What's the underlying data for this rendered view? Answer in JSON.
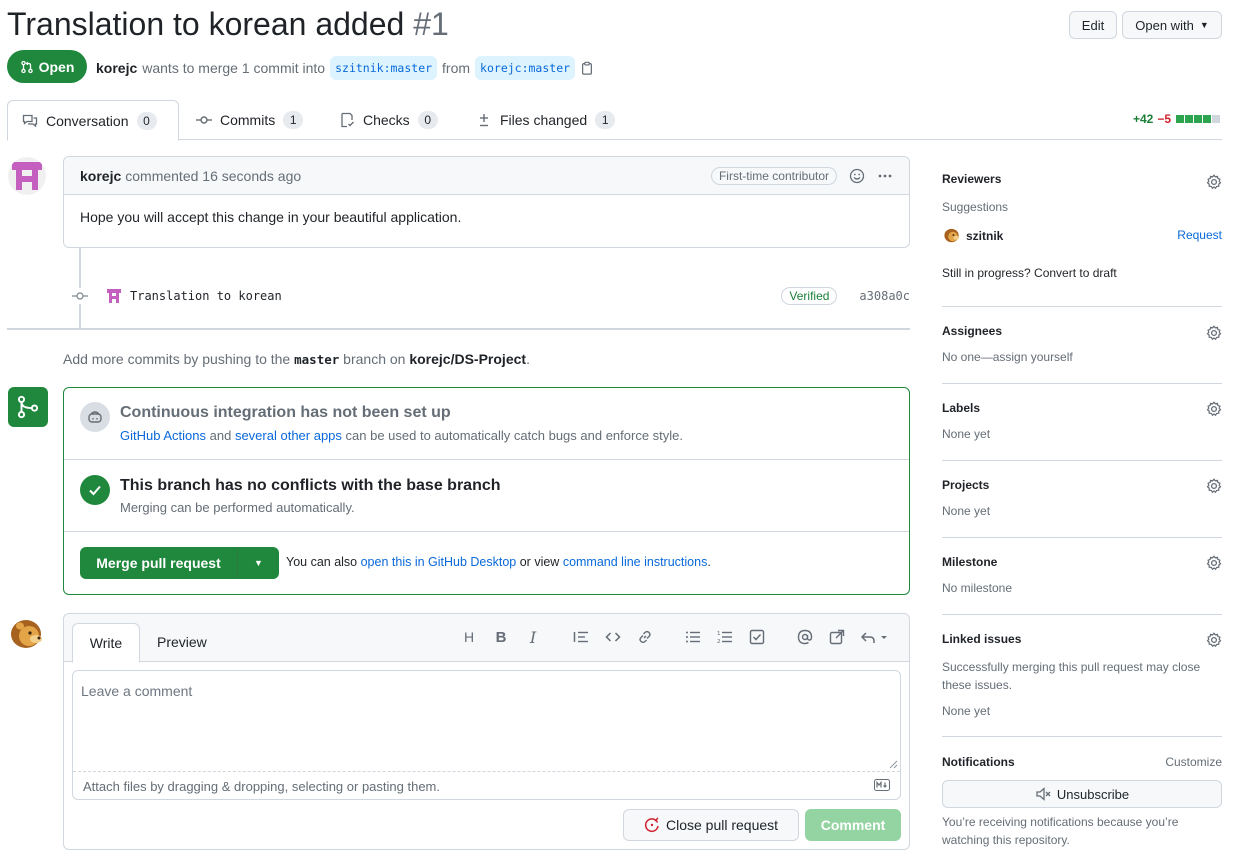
{
  "pr": {
    "title": "Translation to korean added",
    "number": "#1",
    "edit_label": "Edit",
    "open_with_label": "Open with",
    "state": "Open",
    "author": "korejc",
    "meta_text": "wants to merge 1 commit into",
    "base_branch": "szitnik:master",
    "from_text": "from",
    "head_branch": "korejc:master"
  },
  "tabs": [
    {
      "label": "Conversation",
      "count": "0"
    },
    {
      "label": "Commits",
      "count": "1"
    },
    {
      "label": "Checks",
      "count": "0"
    },
    {
      "label": "Files changed",
      "count": "1"
    }
  ],
  "diffstat": {
    "additions": "+42",
    "deletions": "−5"
  },
  "comment": {
    "author": "korejc",
    "time": "commented 16 seconds ago",
    "badge": "First-time contributor",
    "body": "Hope you will accept this change in your beautiful application."
  },
  "commit": {
    "message": "Translation to korean",
    "verified": "Verified",
    "sha": "a308a0c"
  },
  "push_hint": {
    "prefix": "Add more commits by pushing to the",
    "branch": "master",
    "middle": "branch on",
    "repo": "korejc/DS-Project",
    "suffix": "."
  },
  "merge": {
    "ci_title": "Continuous integration has not been set up",
    "ci_link1": "GitHub Actions",
    "ci_and": "and",
    "ci_link2": "several other apps",
    "ci_rest": "can be used to automatically catch bugs and enforce style.",
    "conflict_title": "This branch has no conflicts with the base branch",
    "conflict_sub": "Merging can be performed automatically.",
    "merge_button": "Merge pull request",
    "also_text": "You can also",
    "desktop_link": "open this in GitHub Desktop",
    "or_view": "or view",
    "cli_link": "command line instructions",
    "period": "."
  },
  "form": {
    "write_tab": "Write",
    "preview_tab": "Preview",
    "placeholder": "Leave a comment",
    "attach_text": "Attach files by dragging & dropping, selecting or pasting them.",
    "close_button": "Close pull request",
    "comment_button": "Comment"
  },
  "sidebar": {
    "reviewers": {
      "title": "Reviewers",
      "suggestions": "Suggestions",
      "user": "szitnik",
      "request": "Request",
      "draft_text": "Still in progress? Convert to draft"
    },
    "assignees": {
      "title": "Assignees",
      "text": "No one—assign yourself"
    },
    "labels": {
      "title": "Labels",
      "text": "None yet"
    },
    "projects": {
      "title": "Projects",
      "text": "None yet"
    },
    "milestone": {
      "title": "Milestone",
      "text": "No milestone"
    },
    "linked": {
      "title": "Linked issues",
      "text": "Successfully merging this pull request may close these issues.",
      "none": "None yet"
    },
    "notifications": {
      "title": "Notifications",
      "customize": "Customize",
      "unsubscribe": "Unsubscribe",
      "reason": "You’re receiving notifications because you’re watching this repository."
    }
  },
  "colors": {
    "accent": "#0969da",
    "success": "#1f883d",
    "danger": "#cf222e",
    "border": "#d0d7de"
  }
}
